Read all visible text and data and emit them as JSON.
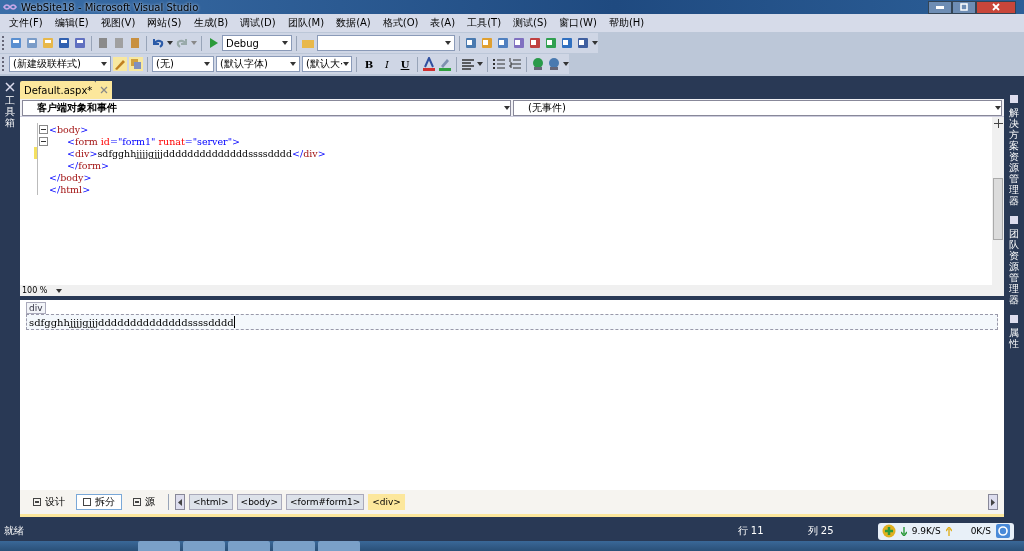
{
  "window": {
    "title": "WebSite18 - Microsoft Visual Studio"
  },
  "menu": [
    "文件(F)",
    "编辑(E)",
    "视图(V)",
    "网站(S)",
    "生成(B)",
    "调试(D)",
    "团队(M)",
    "数据(A)",
    "格式(O)",
    "表(A)",
    "工具(T)",
    "测试(S)",
    "窗口(W)",
    "帮助(H)"
  ],
  "toolbar": {
    "configuration": "Debug"
  },
  "format_toolbar": {
    "style": "(新建级联样式)",
    "block": "(无)",
    "font": "(默认字体)",
    "size": "(默认大·",
    "bold": "B",
    "italic": "I",
    "underline": "U"
  },
  "left_panel": {
    "label": "工具箱"
  },
  "document_tabs": [
    {
      "label": "Default.aspx*",
      "selected": true
    }
  ],
  "object_bar": {
    "objects": "客户端对象和事件",
    "events": "(无事件)"
  },
  "code_lines": [
    {
      "fold": true,
      "modified": false,
      "indented": false,
      "tokens": [
        {
          "kind": "bracket",
          "text": "<"
        },
        {
          "kind": "tag",
          "text": "body"
        },
        {
          "kind": "bracket",
          "text": ">"
        }
      ]
    },
    {
      "fold": true,
      "modified": false,
      "indented": true,
      "tokens": [
        {
          "kind": "bracket",
          "text": "<"
        },
        {
          "kind": "tag",
          "text": "form"
        },
        {
          "kind": "attr",
          "text": " id"
        },
        {
          "kind": "bracket",
          "text": "="
        },
        {
          "kind": "value",
          "text": "\"form1\""
        },
        {
          "kind": "attr",
          "text": " runat"
        },
        {
          "kind": "bracket",
          "text": "="
        },
        {
          "kind": "value",
          "text": "\"server\""
        },
        {
          "kind": "bracket",
          "text": ">"
        }
      ]
    },
    {
      "fold": false,
      "modified": true,
      "indented": true,
      "tokens": [
        {
          "kind": "bracket",
          "text": "<"
        },
        {
          "kind": "tag",
          "text": "div"
        },
        {
          "kind": "bracket",
          "text": ">"
        },
        {
          "kind": "text",
          "text": "sdfgghhjjjjgjjjddddddddddddddssssdddd"
        },
        {
          "kind": "bracket",
          "text": "</"
        },
        {
          "kind": "tag",
          "text": "div"
        },
        {
          "kind": "bracket",
          "text": ">"
        }
      ]
    },
    {
      "fold": false,
      "modified": false,
      "indented": true,
      "tokens": [
        {
          "kind": "bracket",
          "text": "</"
        },
        {
          "kind": "tag",
          "text": "form"
        },
        {
          "kind": "bracket",
          "text": ">"
        }
      ]
    },
    {
      "fold": false,
      "modified": false,
      "indented": false,
      "tokens": [
        {
          "kind": "bracket",
          "text": "</"
        },
        {
          "kind": "tag",
          "text": "body"
        },
        {
          "kind": "bracket",
          "text": ">"
        }
      ]
    },
    {
      "fold": false,
      "modified": false,
      "indented": false,
      "tokens": [
        {
          "kind": "bracket",
          "text": "</"
        },
        {
          "kind": "tag",
          "text": "html"
        },
        {
          "kind": "bracket",
          "text": ">"
        }
      ]
    }
  ],
  "zoom": "100 %",
  "design": {
    "tag": "div",
    "content": "sdfgghhjjjjgjjjddddddddddddddssssdddd"
  },
  "view_tabs": [
    {
      "label": "设计",
      "selected": false
    },
    {
      "label": "拆分",
      "selected": true
    },
    {
      "label": "源",
      "selected": false
    }
  ],
  "breadcrumb": [
    {
      "label": "<html>",
      "selected": false
    },
    {
      "label": "<body>",
      "selected": false
    },
    {
      "label": "<form#form1>",
      "selected": false
    },
    {
      "label": "<div>",
      "selected": true
    }
  ],
  "status_bar": {
    "text": "就绪",
    "line": "行 11",
    "column": "列 25"
  },
  "net_widget": {
    "down": "9.9K/S",
    "up": "0K/S"
  },
  "right_panel": [
    {
      "label": "解决方案资源管理器"
    },
    {
      "label": "团队资源管理器"
    },
    {
      "label": "属性"
    }
  ]
}
